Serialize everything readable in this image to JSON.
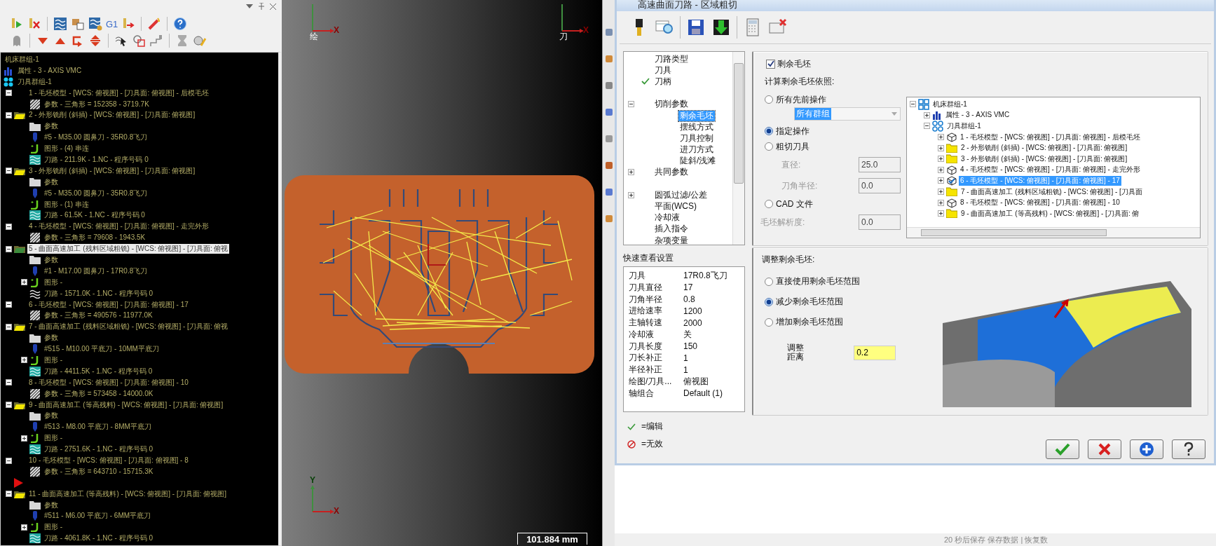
{
  "tree_panel": {
    "toolbar_label": "G1",
    "tree": [
      {
        "label": "机床群组-1",
        "children": [
          {
            "label": "属性 - 3 - AXIS VMC",
            "kind": "machine"
          },
          {
            "label": "刀具群组-1",
            "kind": "group",
            "children": [
              {
                "label": "1 - 毛坯模型 - [WCS: 俯视图] - [刀具面: 俯视图] - 后模毛坯",
                "kind": "stock",
                "expanded": true,
                "selected": false,
                "children": [
                  {
                    "label": "参数 - 三角形 =  152358 - 3719.7K",
                    "kind": "mesh"
                  }
                ]
              },
              {
                "label": "2 - 外形铣削 (斜插) - [WCS: 俯视图] - [刀具面: 俯视图]",
                "kind": "operation",
                "expanded": true,
                "selected": false,
                "children": [
                  {
                    "label": "参数",
                    "kind": "params"
                  },
                  {
                    "label": "#5 - M35.00 圆鼻刀 - 35R0.8飞刀",
                    "kind": "tool"
                  },
                  {
                    "label": "图形 - (4) 串连",
                    "kind": "geometry"
                  },
                  {
                    "label": "刀路 - 211.9K - 1.NC - 程序号码 0",
                    "kind": "path"
                  }
                ]
              },
              {
                "label": "3 - 外形铣削 (斜插) - [WCS: 俯视图] - [刀具面: 俯视图]",
                "kind": "operation",
                "expanded": true,
                "selected": false,
                "children": [
                  {
                    "label": "参数",
                    "kind": "params"
                  },
                  {
                    "label": "#5 - M35.00 圆鼻刀 - 35R0.8飞刀",
                    "kind": "tool"
                  },
                  {
                    "label": "图形 - (1) 串连",
                    "kind": "geometry"
                  },
                  {
                    "label": "刀路 - 61.5K - 1.NC - 程序号码 0",
                    "kind": "path"
                  }
                ]
              },
              {
                "label": "4 - 毛坯模型 - [WCS: 俯视图] - [刀具面: 俯视图] - 走完外形",
                "kind": "stock",
                "expanded": true,
                "selected": false,
                "children": [
                  {
                    "label": "参数 - 三角形 =  79608 - 1943.5K",
                    "kind": "mesh"
                  }
                ]
              },
              {
                "label": "5 - 曲面高速加工 (残料区域粗铣) - [WCS: 俯视图] - [刀具面: 俯视",
                "kind": "operation",
                "expanded": true,
                "selected": true,
                "children": [
                  {
                    "label": "参数",
                    "kind": "params"
                  },
                  {
                    "label": "#1 - M17.00 圆鼻刀 - 17R0.8飞刀",
                    "kind": "tool"
                  },
                  {
                    "label": "图形 -",
                    "kind": "geometry",
                    "expanded": false
                  },
                  {
                    "label": "刀路 - 1571.0K - 1.NC - 程序号码 0",
                    "kind": "path-dirty"
                  }
                ]
              },
              {
                "label": "6 - 毛坯模型 - [WCS: 俯视图] - [刀具面: 俯视图] - 17",
                "kind": "stock",
                "expanded": true,
                "selected": false,
                "children": [
                  {
                    "label": "参数 - 三角形 =  490576 - 11977.0K",
                    "kind": "mesh"
                  }
                ]
              },
              {
                "label": "7 - 曲面高速加工 (残料区域粗铣) - [WCS: 俯视图] - [刀具面: 俯视",
                "kind": "operation",
                "expanded": true,
                "selected": false,
                "children": [
                  {
                    "label": "参数",
                    "kind": "params"
                  },
                  {
                    "label": "#515 - M10.00 平底刀 - 10MM平底刀",
                    "kind": "tool"
                  },
                  {
                    "label": "图形 -",
                    "kind": "geometry",
                    "expanded": false
                  },
                  {
                    "label": "刀路 - 4411.5K - 1.NC - 程序号码 0",
                    "kind": "path"
                  }
                ]
              },
              {
                "label": "8 - 毛坯模型 - [WCS: 俯视图] - [刀具面: 俯视图] - 10",
                "kind": "stock",
                "expanded": true,
                "selected": false,
                "children": [
                  {
                    "label": "参数 - 三角形 =  573458 - 14000.0K",
                    "kind": "mesh"
                  }
                ]
              },
              {
                "label": "9 - 曲面高速加工 (等高残料) - [WCS: 俯视图] - [刀具面: 俯视图]",
                "kind": "operation",
                "expanded": true,
                "selected": false,
                "children": [
                  {
                    "label": "参数",
                    "kind": "params"
                  },
                  {
                    "label": "#513 - M8.00 平底刀 - 8MM平底刀",
                    "kind": "tool"
                  },
                  {
                    "label": "图形 -",
                    "kind": "geometry",
                    "expanded": false
                  },
                  {
                    "label": "刀路 - 2751.6K - 1.NC - 程序号码 0",
                    "kind": "path"
                  }
                ]
              },
              {
                "label": "10 - 毛坯模型 - [WCS: 俯视图] - [刀具面: 俯视图] - 8",
                "kind": "stock",
                "expanded": true,
                "selected": false,
                "children": [
                  {
                    "label": "参数 - 三角形 =  643710 - 15715.3K",
                    "kind": "mesh"
                  }
                ]
              },
              {
                "kind": "marker",
                "selected": false
              },
              {
                "label": "11 - 曲面高速加工 (等高残料) - [WCS: 俯视图] - [刀具面: 俯视图]",
                "kind": "operation",
                "expanded": true,
                "selected": false,
                "children": [
                  {
                    "label": "参数",
                    "kind": "params"
                  },
                  {
                    "label": "#511 - M6.00 平底刀 - 6MM平底刀",
                    "kind": "tool"
                  },
                  {
                    "label": "图形 -",
                    "kind": "geometry",
                    "expanded": false
                  },
                  {
                    "label": "刀路 - 4061.8K - 1.NC - 程序号码 0",
                    "kind": "path"
                  }
                ]
              }
            ]
          }
        ]
      }
    ]
  },
  "viewport": {
    "wcs_gnomon": {
      "label": "绘",
      "x_label": "X"
    },
    "tool_gnomon": {
      "label": "刀",
      "x_label": "X"
    },
    "view_gnomon": {
      "x_label": "X",
      "y_label": "Y"
    },
    "scale": "101.884 mm"
  },
  "dialog": {
    "title": "高速曲面刀路 - 区域粗切",
    "nav": [
      {
        "label": "刀路类型",
        "kind": "item",
        "edited": false,
        "selected": false
      },
      {
        "label": "刀具",
        "kind": "item",
        "edited": false,
        "selected": false
      },
      {
        "label": "刀柄",
        "kind": "item",
        "edited": true,
        "selected": false
      },
      {
        "kind": "blank"
      },
      {
        "label": "切削参数",
        "kind": "item",
        "edited": false,
        "selected": false,
        "expanded": true,
        "children": [
          {
            "label": "剩余毛坯",
            "kind": "item",
            "edited": false,
            "selected": true
          },
          {
            "label": "摆线方式",
            "kind": "item",
            "edited": false,
            "selected": false
          },
          {
            "label": "刀具控制",
            "kind": "item",
            "edited": false,
            "selected": false
          },
          {
            "label": "进刀方式",
            "kind": "item",
            "edited": false,
            "selected": false
          },
          {
            "label": "陡斜/浅滩",
            "kind": "item",
            "edited": false,
            "selected": false
          }
        ]
      },
      {
        "label": "共同参数",
        "kind": "item",
        "edited": false,
        "selected": false,
        "expanded": false
      },
      {
        "kind": "blank"
      },
      {
        "label": "圆弧过滤/公差",
        "kind": "item",
        "edited": false,
        "selected": false,
        "expanded": false
      },
      {
        "label": "平面(WCS)",
        "kind": "item",
        "edited": false,
        "selected": false
      },
      {
        "label": "冷却液",
        "kind": "item",
        "edited": false,
        "selected": false
      },
      {
        "label": "插入指令",
        "kind": "item",
        "edited": false,
        "selected": false
      },
      {
        "label": "杂项变量",
        "kind": "item",
        "edited": false,
        "selected": false
      }
    ],
    "quick_view": {
      "title": "快速查看设置",
      "rows": [
        {
          "key": "刀具",
          "value": "17R0.8飞刀"
        },
        {
          "key": "刀具直径",
          "value": "17"
        },
        {
          "key": "刀角半径",
          "value": "0.8"
        },
        {
          "key": "进给速率",
          "value": "1200"
        },
        {
          "key": "主轴转速",
          "value": "2000"
        },
        {
          "key": "冷却液",
          "value": "关"
        },
        {
          "key": "刀具长度",
          "value": "150"
        },
        {
          "key": "刀长补正",
          "value": "1"
        },
        {
          "key": "半径补正",
          "value": "1"
        },
        {
          "key": "绘图/刀具...",
          "value": "俯视图"
        },
        {
          "key": "轴组合",
          "value": "Default (1)"
        }
      ]
    },
    "legend": [
      {
        "kind": "edited",
        "text": "=编辑"
      },
      {
        "kind": "invalid",
        "text": "=无效"
      }
    ],
    "remaining_stock": {
      "label": "剩余毛坯",
      "checked": true,
      "basis_label": "计算剩余毛坯依照:",
      "options": [
        {
          "label": "所有先前操作",
          "selected": false
        },
        {
          "label": "指定操作",
          "selected": true
        },
        {
          "label": "粗切刀具",
          "selected": false
        },
        {
          "label": "CAD 文件",
          "selected": false
        }
      ],
      "group_select": {
        "value": "所有群组",
        "disabled": true
      },
      "fields": [
        {
          "label": "直径:",
          "value": "25.0",
          "disabled": true
        },
        {
          "label": "刀角半径:",
          "value": "0.0",
          "disabled": true
        }
      ],
      "resolution": {
        "label": "毛坯解析度:",
        "value": "0.0",
        "disabled": true
      },
      "ops_tree": [
        {
          "label": "机床群组-1",
          "kind": "root",
          "expanded": true,
          "children": [
            {
              "label": "属性 - 3 - AXIS VMC",
              "kind": "machine",
              "expanded": false
            },
            {
              "label": "刀具群组-1",
              "kind": "group",
              "expanded": true,
              "children": [
                {
                  "label": "1 - 毛坯模型 - [WCS: 俯视图] - [刀具面: 俯视图] - 后模毛坯",
                  "kind": "stock",
                  "expanded": false,
                  "selected": false
                },
                {
                  "label": "2 - 外形铣削 (斜插) - [WCS: 俯视图] - [刀具面: 俯视图]",
                  "kind": "operation",
                  "expanded": false,
                  "selected": false
                },
                {
                  "label": "3 - 外形铣削 (斜插) - [WCS: 俯视图] - [刀具面: 俯视图]",
                  "kind": "operation",
                  "expanded": false,
                  "selected": false
                },
                {
                  "label": "4 - 毛坯模型 - [WCS: 俯视图] - [刀具面: 俯视图] - 走完外形",
                  "kind": "stock",
                  "expanded": false,
                  "selected": false
                },
                {
                  "label": "6 - 毛坯模型 - [WCS: 俯视图] - [刀具面: 俯视图] - 17",
                  "kind": "stock",
                  "expanded": false,
                  "selected": true
                },
                {
                  "label": "7 - 曲面高速加工 (残料区域粗铣) - [WCS: 俯视图] - [刀具面",
                  "kind": "operation",
                  "expanded": false,
                  "selected": false
                },
                {
                  "label": "8 - 毛坯模型 - [WCS: 俯视图] - [刀具面: 俯视图] - 10",
                  "kind": "stock",
                  "expanded": false,
                  "selected": false
                },
                {
                  "label": "9 - 曲面高速加工 (等高残料) - [WCS: 俯视图] - [刀具面: 俯",
                  "kind": "operation",
                  "expanded": false,
                  "selected": false
                }
              ]
            }
          ]
        }
      ]
    },
    "adjust": {
      "title": "调整剩余毛坯:",
      "options": [
        {
          "label": "直接使用剩余毛坯范围",
          "selected": false
        },
        {
          "label": "减少剩余毛坯范围",
          "selected": true
        },
        {
          "label": "增加剩余毛坯范围",
          "selected": false
        }
      ],
      "distance_label": "调整距离",
      "distance_value": "0.2"
    },
    "buttons": [
      {
        "kind": "ok"
      },
      {
        "kind": "cancel"
      },
      {
        "kind": "add"
      },
      {
        "kind": "help"
      }
    ]
  },
  "status_bar": "20 秒后保存 保存数据 | 恢复数"
}
